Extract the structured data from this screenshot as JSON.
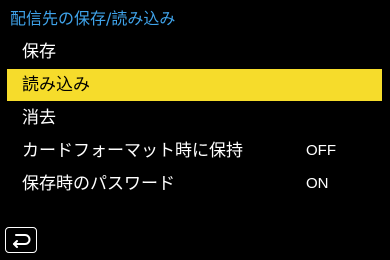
{
  "header": {
    "title": "配信先の保存/読み込み"
  },
  "menu": {
    "items": [
      {
        "label": "保存",
        "value": ""
      },
      {
        "label": "読み込み",
        "value": "",
        "selected": true
      },
      {
        "label": "消去",
        "value": ""
      },
      {
        "label": "カードフォーマット時に保持",
        "value": "OFF"
      },
      {
        "label": "保存時のパスワード",
        "value": "ON"
      }
    ]
  },
  "footer": {
    "back_icon": "return-arrow-icon"
  },
  "colors": {
    "background": "#000000",
    "title": "#3fa3ea",
    "selection": "#f6dc2b",
    "text": "#ffffff",
    "selected_text": "#000000"
  }
}
